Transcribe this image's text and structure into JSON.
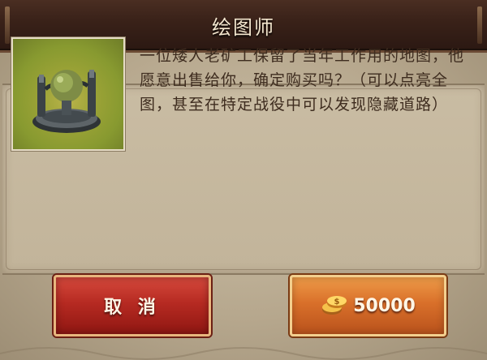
{
  "dialog": {
    "title": "绘图师",
    "description": "一位矮人老矿工保留了当年工作用的地图，他愿意出售给你，确定购买吗？（可以点亮全图，甚至在特定战役中可以发现隐藏道路）",
    "portrait_icon": "map-pedestal-icon",
    "cancel_label": "取 消",
    "buy_price": "50000",
    "currency_icon": "gold-coins-icon"
  },
  "colors": {
    "cancel_button": "#b62a22",
    "buy_button": "#d9702a",
    "panel": "#c2b49a",
    "titlebar": "#3a2219"
  }
}
